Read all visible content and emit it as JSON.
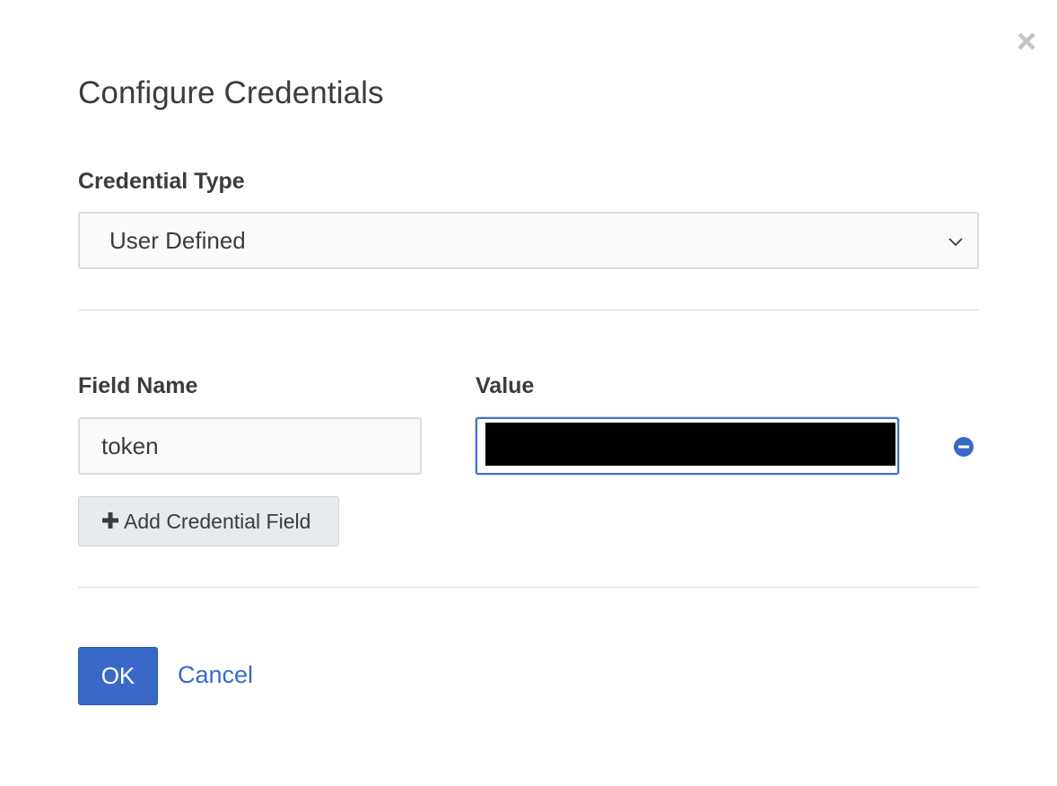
{
  "dialog": {
    "title": "Configure Credentials",
    "close_icon": "close-icon"
  },
  "credential_type": {
    "label": "Credential Type",
    "selected": "User Defined",
    "chevron_icon": "chevron-down-icon"
  },
  "fields": {
    "name_header": "Field Name",
    "value_header": "Value",
    "rows": [
      {
        "name": "token",
        "value": ""
      }
    ],
    "remove_icon": "minus-circle-icon"
  },
  "add_field": {
    "label": "Add Credential Field",
    "icon": "plus-icon"
  },
  "footer": {
    "ok_label": "OK",
    "cancel_label": "Cancel"
  },
  "colors": {
    "primary": "#3a68c9",
    "text": "#3a3c3f",
    "focus_border": "#3a6fd8"
  }
}
